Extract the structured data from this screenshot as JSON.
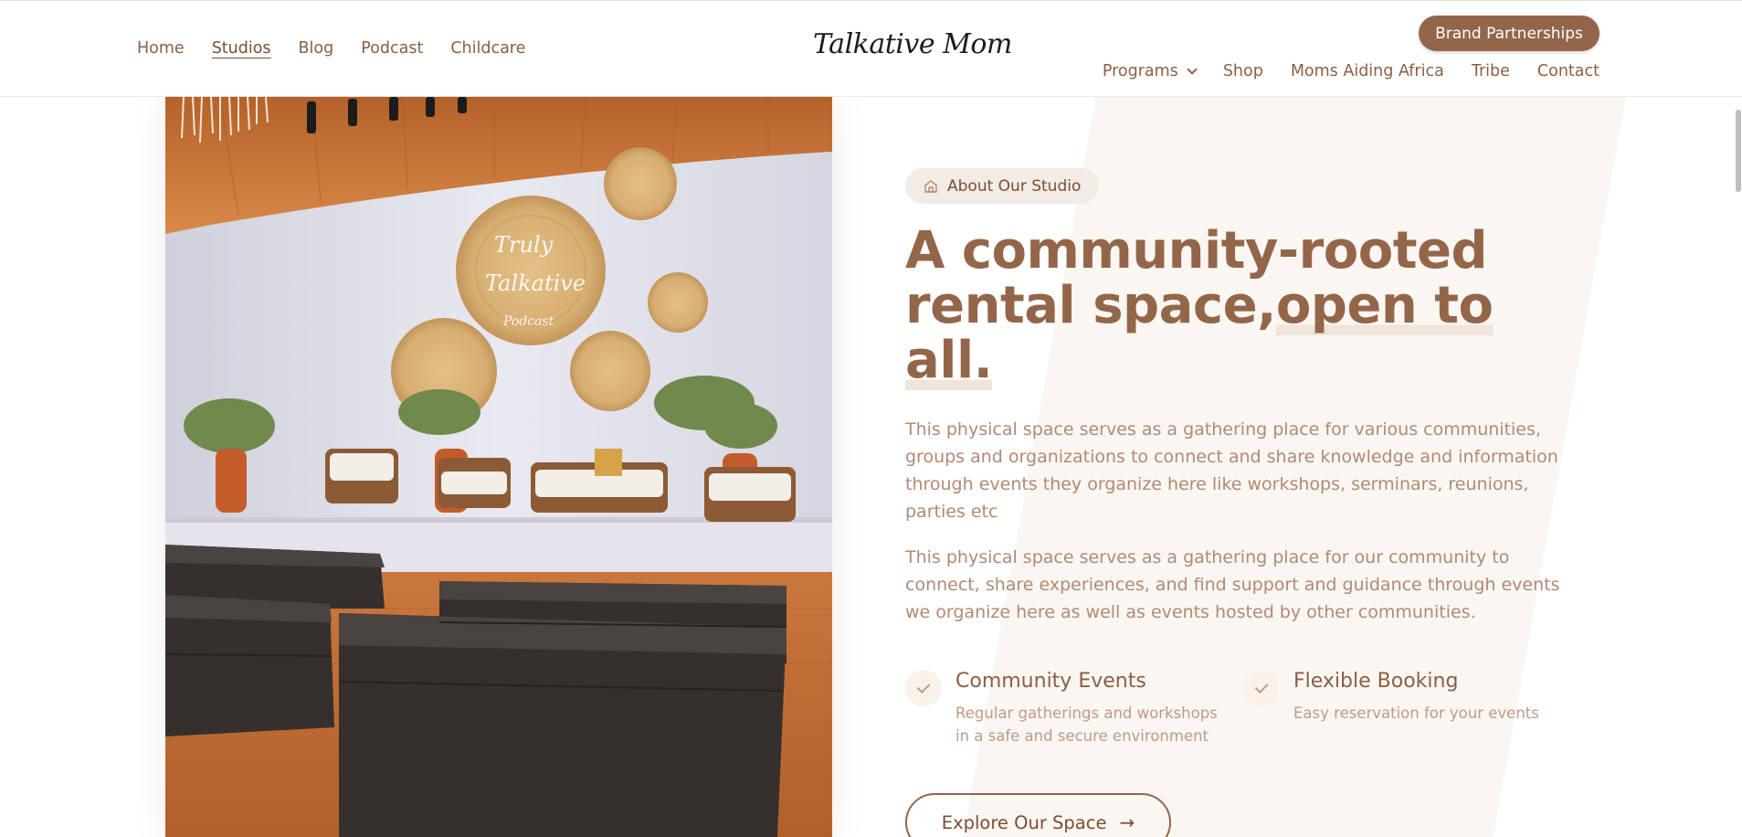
{
  "nav": {
    "left": [
      "Home",
      "Studios",
      "Blog",
      "Podcast",
      "Childcare"
    ],
    "active": "Studios",
    "logo": "Talkative Mom",
    "brand_button": "Brand Partnerships",
    "right": [
      "Programs",
      "Shop",
      "Moms Aiding Africa",
      "Tribe",
      "Contact"
    ]
  },
  "photo": {
    "wall_sign": [
      "Truly",
      "Talkative",
      "Podcast"
    ]
  },
  "about": {
    "badge": "About Our Studio",
    "headline_line1": "A community-rooted",
    "headline_line2a": "rental space,",
    "headline_line2b": "open to all.",
    "para1": "This physical space serves as a gathering place for various communities, groups and organizations to connect and share knowledge and information through events they organize here like workshops, serminars, reunions, parties etc",
    "para2": "This physical space serves as a gathering place for our community to connect, share experiences, and find support and guidance through events we organize here as well as events hosted by other communities.",
    "features": [
      {
        "title": "Community Events",
        "desc": "Regular gatherings and workshops in a safe and secure environment"
      },
      {
        "title": "Flexible Booking",
        "desc": "Easy reservation for your events"
      }
    ],
    "cta": "Explore Our Space"
  },
  "colors": {
    "brand": "#93664a",
    "text": "#8a5f44",
    "muted": "#b08a74",
    "panel": "#faf6f2"
  }
}
